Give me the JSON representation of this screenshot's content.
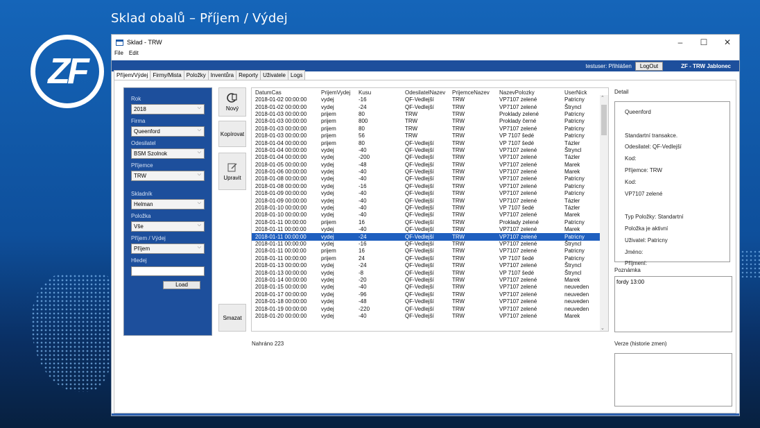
{
  "slide": {
    "title": "Sklad obalů – Příjem / Výdej",
    "logo_text": "ZF"
  },
  "window": {
    "title": "Sklad - TRW",
    "controls": [
      "–",
      "☐",
      "✕"
    ],
    "menu": [
      "File",
      "Edit"
    ]
  },
  "userbar": {
    "status": "testuser: Přihlášen",
    "logout_label": "LogOut",
    "brand": "ZF - TRW Jablonec"
  },
  "tabs": [
    "Příjem/Výdej",
    "Firmy/Mista",
    "Položky",
    "Inventůra",
    "Reporty",
    "Uživatele",
    "Logs"
  ],
  "filters": {
    "rok_label": "Rok",
    "rok_value": "2018",
    "firma_label": "Firma",
    "firma_value": "Queenford",
    "odesilatel_label": "Odesilatel",
    "odesilatel_value": "BSM Szolnok",
    "prijemce_label": "Příjemce",
    "prijemce_value": "TRW",
    "skladnik_label": "Skladník",
    "skladnik_value": "Helman",
    "polozka_label": "Položka",
    "polozka_value": "Vše",
    "prijemvydej_label": "Příjem / Výdej",
    "prijemvydej_value": "Příjem",
    "hledej_label": "Hledej",
    "hledej_value": "",
    "load_label": "Load"
  },
  "actions": {
    "new_label": "Nový",
    "copy_label": "Kopírovat",
    "edit_label": "Upravit",
    "delete_label": "Smazat"
  },
  "grid": {
    "columns": [
      "DatumCas",
      "PrijemVydej",
      "Kusu",
      "OdesilatelNazev",
      "PrijemceNazev",
      "NazevPolozky",
      "UserNick"
    ],
    "selected_index": 19,
    "rows": [
      [
        "2018-01-02 00:00:00",
        "vydej",
        "-16",
        "QF-Vedlejší",
        "TRW",
        "VP7107 zelené",
        "Patricny"
      ],
      [
        "2018-01-02 00:00:00",
        "vydej",
        "-24",
        "QF-Vedlejší",
        "TRW",
        "VP7107 zelené",
        "Štryncl"
      ],
      [
        "2018-01-03 00:00:00",
        "prijem",
        "80",
        "TRW",
        "TRW",
        "Proklady zelené",
        "Patricny"
      ],
      [
        "2018-01-03 00:00:00",
        "prijem",
        "800",
        "TRW",
        "TRW",
        "Proklady černé",
        "Patricny"
      ],
      [
        "2018-01-03 00:00:00",
        "prijem",
        "80",
        "TRW",
        "TRW",
        "VP7107 zelené",
        "Patricny"
      ],
      [
        "2018-01-03 00:00:00",
        "prijem",
        "56",
        "TRW",
        "TRW",
        "VP 7107 šedé",
        "Patricny"
      ],
      [
        "2018-01-04 00:00:00",
        "prijem",
        "80",
        "QF-Vedlejší",
        "TRW",
        "VP 7107 šedé",
        "Tázler"
      ],
      [
        "2018-01-04 00:00:00",
        "vydej",
        "-40",
        "QF-Vedlejší",
        "TRW",
        "VP7107 zelené",
        "Štryncl"
      ],
      [
        "2018-01-04 00:00:00",
        "vydej",
        "-200",
        "QF-Vedlejší",
        "TRW",
        "VP7107 zelené",
        "Tázler"
      ],
      [
        "2018-01-05 00:00:00",
        "vydej",
        "-48",
        "QF-Vedlejší",
        "TRW",
        "VP7107 zelené",
        "Marek"
      ],
      [
        "2018-01-06 00:00:00",
        "vydej",
        "-40",
        "QF-Vedlejší",
        "TRW",
        "VP7107 zelené",
        "Marek"
      ],
      [
        "2018-01-08 00:00:00",
        "vydej",
        "-40",
        "QF-Vedlejší",
        "TRW",
        "VP7107 zelené",
        "Patricny"
      ],
      [
        "2018-01-08 00:00:00",
        "vydej",
        "-16",
        "QF-Vedlejší",
        "TRW",
        "VP7107 zelené",
        "Patricny"
      ],
      [
        "2018-01-09 00:00:00",
        "vydej",
        "-40",
        "QF-Vedlejší",
        "TRW",
        "VP7107 zelené",
        "Patricny"
      ],
      [
        "2018-01-09 00:00:00",
        "vydej",
        "-40",
        "QF-Vedlejší",
        "TRW",
        "VP7107 zelené",
        "Tázler"
      ],
      [
        "2018-01-10 00:00:00",
        "vydej",
        "-40",
        "QF-Vedlejší",
        "TRW",
        "VP 7107 šedé",
        "Tázler"
      ],
      [
        "2018-01-10 00:00:00",
        "vydej",
        "-40",
        "QF-Vedlejší",
        "TRW",
        "VP7107 zelené",
        "Marek"
      ],
      [
        "2018-01-11 00:00:00",
        "prijem",
        "16",
        "QF-Vedlejší",
        "TRW",
        "Proklady zelené",
        "Patricny"
      ],
      [
        "2018-01-11 00:00:00",
        "vydej",
        "-40",
        "QF-Vedlejší",
        "TRW",
        "VP7107 zelené",
        "Marek"
      ],
      [
        "2018-01-11 00:00:00",
        "vydej",
        "-24",
        "QF-Vedlejší",
        "TRW",
        "VP7107 zelené",
        "Patricny"
      ],
      [
        "2018-01-11 00:00:00",
        "vydej",
        "-16",
        "QF-Vedlejší",
        "TRW",
        "VP7107 zelené",
        "Štryncl"
      ],
      [
        "2018-01-11 00:00:00",
        "prijem",
        "16",
        "QF-Vedlejší",
        "TRW",
        "VP7107 zelené",
        "Patricny"
      ],
      [
        "2018-01-11 00:00:00",
        "prijem",
        "24",
        "QF-Vedlejší",
        "TRW",
        "VP 7107 šedé",
        "Patricny"
      ],
      [
        "2018-01-13 00:00:00",
        "vydej",
        "-24",
        "QF-Vedlejší",
        "TRW",
        "VP7107 zelené",
        "Štryncl"
      ],
      [
        "2018-01-13 00:00:00",
        "vydej",
        "-8",
        "QF-Vedlejší",
        "TRW",
        "VP 7107 šedé",
        "Štryncl"
      ],
      [
        "2018-01-14 00:00:00",
        "vydej",
        "-20",
        "QF-Vedlejší",
        "TRW",
        "VP7107 zelené",
        "Marek"
      ],
      [
        "2018-01-15 00:00:00",
        "vydej",
        "-40",
        "QF-Vedlejší",
        "TRW",
        "VP7107 zelené",
        "neuveden"
      ],
      [
        "2018-01-17 00:00:00",
        "vydej",
        "-96",
        "QF-Vedlejší",
        "TRW",
        "VP7107 zelené",
        "neuveden"
      ],
      [
        "2018-01-18 00:00:00",
        "vydej",
        "-48",
        "QF-Vedlejší",
        "TRW",
        "VP7107 zelené",
        "neuveden"
      ],
      [
        "2018-01-19 00:00:00",
        "vydej",
        "-220",
        "QF-Vedlejší",
        "TRW",
        "VP7107 zelené",
        "neuveden"
      ],
      [
        "2018-01-20 00:00:00",
        "vydej",
        "-40",
        "QF-Vedlejší",
        "TRW",
        "VP7107 zelené",
        "Marek"
      ]
    ],
    "loaded_text": "Nahráno 223"
  },
  "detail": {
    "label": "Detail",
    "lines": [
      "Queenford",
      "",
      "Standartní transakce.",
      "Odesilatel: QF-Vedlejší",
      "Kod:",
      "Příjemce: TRW",
      "Kod:",
      "VP7107 zelené",
      "",
      "Typ Položky: Standartní",
      "Položka je aktivní",
      "Uživatel: Patricny",
      "Jméno:",
      "Příjmení:"
    ]
  },
  "note": {
    "label": "Poznámka",
    "value": "fordy 13:00"
  },
  "version": {
    "label": "Verze (historie zmen)"
  },
  "colors": {
    "accent": "#1d4f9c",
    "selection": "#1f5fbf"
  }
}
